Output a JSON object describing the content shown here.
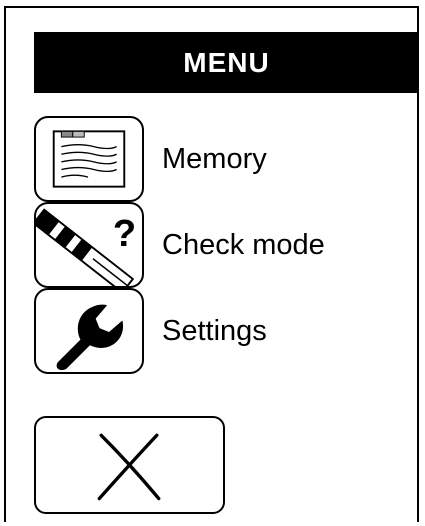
{
  "header": {
    "title": "MENU"
  },
  "menu": {
    "items": [
      {
        "label": "Memory",
        "icon": "memory-document-icon"
      },
      {
        "label": "Check mode",
        "icon": "check-strip-question-icon"
      },
      {
        "label": "Settings",
        "icon": "wrench-icon"
      }
    ]
  },
  "close_button": {
    "icon": "close-x-icon"
  },
  "colors": {
    "background": "#ffffff",
    "foreground": "#000000",
    "title_bar": "#000000",
    "title_text": "#ffffff"
  }
}
